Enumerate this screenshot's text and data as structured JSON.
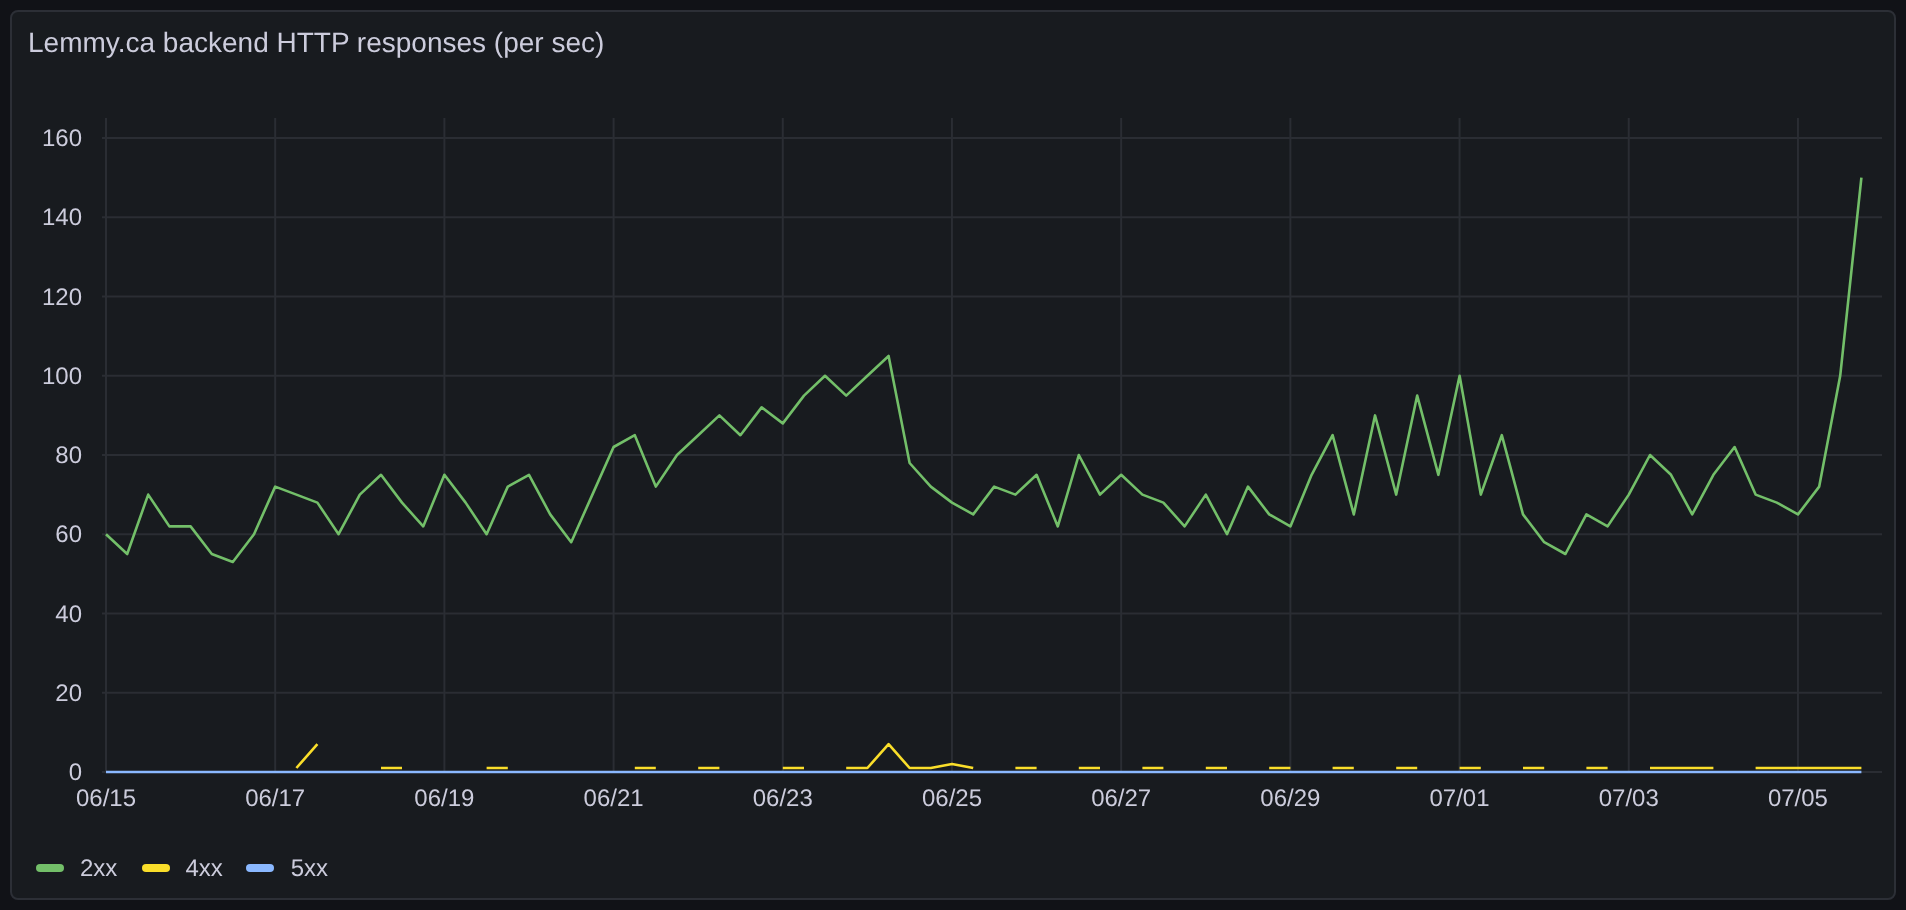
{
  "panel": {
    "title": "Lemmy.ca backend HTTP responses (per sec)",
    "chart_data": {
      "type": "line",
      "categories": [
        "06/15",
        null,
        null,
        null,
        null,
        null,
        null,
        null,
        "06/17",
        null,
        null,
        null,
        null,
        null,
        null,
        null,
        "06/19",
        null,
        null,
        null,
        null,
        null,
        null,
        null,
        "06/21",
        null,
        null,
        null,
        null,
        null,
        null,
        null,
        "06/23",
        null,
        null,
        null,
        null,
        null,
        null,
        null,
        "06/25",
        null,
        null,
        null,
        null,
        null,
        null,
        null,
        "06/27",
        null,
        null,
        null,
        null,
        null,
        null,
        null,
        "06/29",
        null,
        null,
        null,
        null,
        null,
        null,
        null,
        "07/01",
        null,
        null,
        null,
        null,
        null,
        null,
        null,
        "07/03",
        null,
        null,
        null,
        null,
        null,
        null,
        null,
        "07/05",
        null,
        null,
        null
      ],
      "series": [
        {
          "name": "2xx",
          "color": "#73bf69",
          "values": [
            60,
            55,
            70,
            62,
            62,
            55,
            53,
            60,
            72,
            70,
            68,
            60,
            70,
            75,
            68,
            62,
            75,
            68,
            60,
            72,
            75,
            65,
            58,
            70,
            82,
            85,
            72,
            80,
            85,
            90,
            85,
            92,
            88,
            95,
            100,
            95,
            100,
            105,
            78,
            72,
            68,
            65,
            72,
            70,
            75,
            62,
            80,
            70,
            75,
            70,
            68,
            62,
            70,
            60,
            72,
            65,
            62,
            75,
            85,
            65,
            90,
            70,
            95,
            75,
            100,
            70,
            85,
            65,
            58,
            55,
            65,
            62,
            70,
            80,
            75,
            65,
            75,
            82,
            70,
            68,
            65,
            72,
            100,
            150
          ]
        },
        {
          "name": "4xx",
          "color": "#fade2a",
          "values": [
            null,
            null,
            null,
            null,
            null,
            null,
            null,
            null,
            null,
            1,
            7,
            null,
            null,
            1,
            1,
            null,
            null,
            null,
            1,
            1,
            null,
            null,
            null,
            null,
            null,
            1,
            1,
            null,
            1,
            1,
            null,
            null,
            1,
            1,
            null,
            1,
            1,
            7,
            1,
            1,
            2,
            1,
            null,
            1,
            1,
            null,
            1,
            1,
            null,
            1,
            1,
            null,
            1,
            1,
            null,
            1,
            1,
            null,
            1,
            1,
            null,
            1,
            1,
            null,
            1,
            1,
            null,
            1,
            1,
            null,
            1,
            1,
            null,
            1,
            1,
            1,
            1,
            null,
            1,
            1,
            1,
            1,
            1,
            1
          ]
        },
        {
          "name": "5xx",
          "color": "#8ab8ff",
          "values": [
            0,
            0,
            0,
            0,
            0,
            0,
            0,
            0,
            0,
            0,
            0,
            0,
            0,
            0,
            0,
            0,
            0,
            0,
            0,
            0,
            0,
            0,
            0,
            0,
            0,
            0,
            0,
            0,
            0,
            0,
            0,
            0,
            0,
            0,
            0,
            0,
            0,
            0,
            0,
            0,
            0,
            0,
            0,
            0,
            0,
            0,
            0,
            0,
            0,
            0,
            0,
            0,
            0,
            0,
            0,
            0,
            0,
            0,
            0,
            0,
            0,
            0,
            0,
            0,
            0,
            0,
            0,
            0,
            0,
            0,
            0,
            0,
            0,
            0,
            0,
            0,
            0,
            0,
            0,
            0,
            0,
            0,
            0,
            0
          ]
        }
      ],
      "ylim": [
        0,
        160
      ],
      "grid": true,
      "yticks": [
        0,
        20,
        40,
        60,
        80,
        100,
        120,
        140,
        160
      ]
    }
  }
}
